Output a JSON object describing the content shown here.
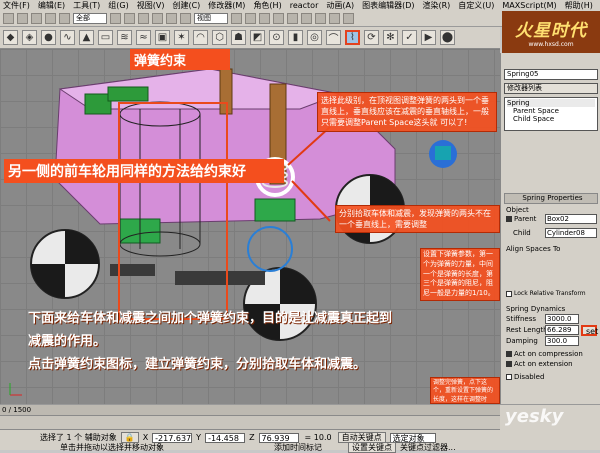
{
  "menubar": {
    "items": [
      "文件(F)",
      "编辑(E)",
      "工具(T)",
      "组(G)",
      "视图(V)",
      "创建(C)",
      "修改器(M)",
      "角色(H)",
      "reactor",
      "动画(A)",
      "图表编辑器(D)",
      "渲染(R)",
      "自定义(U)",
      "MAXScript(M)",
      "帮助(H)"
    ]
  },
  "toolbar1": {
    "selection_filter": "全部",
    "ref_coord": "视图"
  },
  "logo": {
    "main": "火星时代",
    "sub": "www.hxsd.com"
  },
  "annotations": {
    "spring_constraint_label": "弹簧约束",
    "top_note": "选择此级别，在顶视图调整弹簧的两头到一个垂直线上，垂直线应该在减震的垂直轴线上，一般只需要调整Parent Space这头就 可以了!",
    "left_big": "另一侧的前车轮用同样的方法给约束好",
    "pick_note": "分别拾取车体和减震，发现弹簧的两头不在一个垂直线上，需要调整",
    "params_note": "设置下弹簧参数，第一个为弹簧的力量，中间一个是弹簧的长度，第三个是弹簧的阻尼，阻尼一般是力量的1/10。",
    "bottom_big_1": "下面来给车体和减震之间加个弹簧约束，目的是让减震真正起到",
    "bottom_big_2": "减震的作用。",
    "bottom_big_3": "点击弹簧约束图标，建立弹簧约束，分别拾取车体和减震。",
    "set_note": "调整完弹簧，点下这个，重新设置下弹簧的长度，这样在调整时候，弹簧的长度就不会改变了"
  },
  "panel": {
    "object_name": "Spring05",
    "modifier_list": "修改器列表",
    "stack": [
      "Spring",
      "Parent Space",
      "Child Space"
    ],
    "rollout_title": "Spring Properties",
    "object_group": "Object",
    "parent_label": "Parent",
    "parent_value": "Box02",
    "child_label": "Child",
    "child_value": "Cylinder08",
    "align_title": "Align Spaces To",
    "lock_label": "Lock Relative Transform",
    "dynamics_title": "Spring Dynamics",
    "stiffness_label": "Stiffness",
    "stiffness_value": "3000.0",
    "rest_length_label": "Rest Length",
    "rest_length_value": "66.289",
    "damping_label": "Damping",
    "damping_value": "300.0",
    "set_label": "set",
    "act_compression": "Act on compression",
    "act_extension": "Act on extension",
    "disabled_label": "Disabled"
  },
  "timeline": {
    "frame": "0 / 1500"
  },
  "status": {
    "selected_text": "选择了 1 个 辅助对象",
    "hint_text": "单击并拖动以选择并移动对象",
    "x_value": "-217.637",
    "y_value": "-14.458",
    "z_value": "76.939",
    "grid": "= 10.0",
    "auto_key": "自动关键点",
    "set_key": "设置关键点",
    "selected_obj": "选定对象",
    "add_time_tag": "添加时间标记",
    "key_filters": "关键点过滤器..."
  },
  "watermark": "yesky",
  "colors": {
    "callout": "#f44f1e",
    "car_pink": "#d48ed8",
    "panel_bg": "#d4d0c8",
    "viewport_bg": "#898989"
  }
}
